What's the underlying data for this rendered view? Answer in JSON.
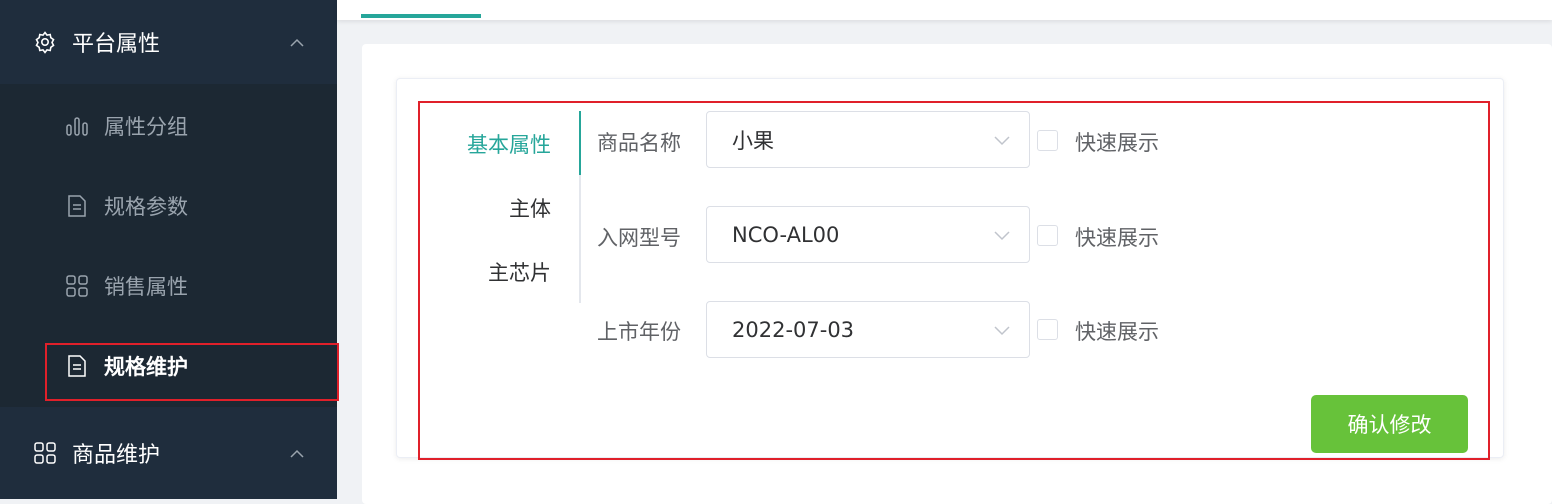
{
  "sidebar": {
    "group1": {
      "label": "平台属性",
      "icon": "gear-icon"
    },
    "items": [
      {
        "label": "属性分组",
        "icon": "bar-chart-icon"
      },
      {
        "label": "规格参数",
        "icon": "document-icon"
      },
      {
        "label": "销售属性",
        "icon": "grid-icon"
      },
      {
        "label": "规格维护",
        "icon": "document-icon",
        "active": true
      }
    ],
    "group2": {
      "label": "商品维护",
      "icon": "grid-icon"
    }
  },
  "tabs": [
    {
      "label": "基本属性",
      "active": true
    },
    {
      "label": "主体"
    },
    {
      "label": "主芯片"
    }
  ],
  "form": {
    "rows": [
      {
        "label": "商品名称",
        "value": "小果",
        "checkbox_label": "快速展示"
      },
      {
        "label": "入网型号",
        "value": "NCO-AL00",
        "checkbox_label": "快速展示"
      },
      {
        "label": "上市年份",
        "value": "2022-07-03",
        "checkbox_label": "快速展示"
      }
    ],
    "submit_label": "确认修改"
  },
  "colors": {
    "sidebar_bg": "#1f2d3d",
    "accent": "#26a69a",
    "button": "#67c23a",
    "highlight": "#e0202a"
  }
}
